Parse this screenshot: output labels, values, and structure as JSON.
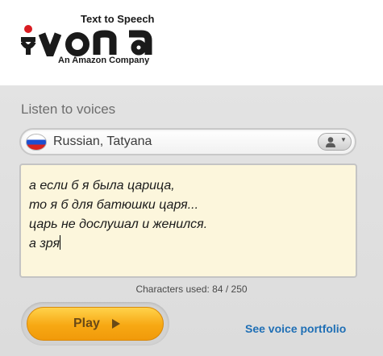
{
  "logo": {
    "tagline_top": "Text to Speech",
    "tagline_bottom": "An Amazon Company",
    "brand_color": "#d91b21",
    "wordmark_color": "#1a1a1a"
  },
  "section": {
    "title": "Listen to voices"
  },
  "voice_selector": {
    "selected_voice": "Russian, Tatyana",
    "flag_icon": "russia-flag-icon",
    "menu_icon": "user-icon"
  },
  "text_input": {
    "lines": [
      "а если б я была царица,",
      "то я б для батюшки царя...",
      "царь не дослушал и женился.",
      "а зря"
    ]
  },
  "char_counter": {
    "text": "Characters used: 84 / 250"
  },
  "play_button": {
    "label": "Play",
    "icon": "play-icon",
    "color": "#f7a813"
  },
  "portfolio_link": {
    "label": "See voice portfolio",
    "color": "#1f6fb5"
  }
}
